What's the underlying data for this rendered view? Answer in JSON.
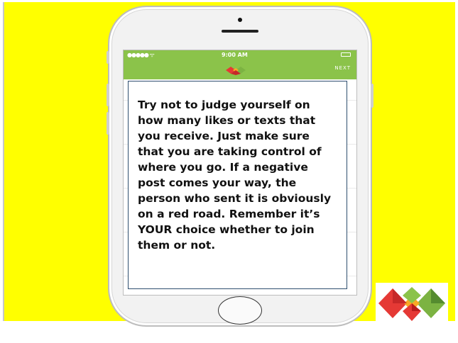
{
  "status_bar": {
    "signal": "●●●●● ᯤ",
    "time": "9:00 AM"
  },
  "nav_bar": {
    "next_label": "NEXT"
  },
  "message": {
    "text": "Try not to judge yourself on\nhow many likes or texts that\nyou receive. Just make sure\nthat you are taking control of\nwhere you go. If a negative\npost comes your way, the\nperson who sent it is obviously\non a red road. Remember it’s\nYOUR choice whether to join\nthem or not."
  },
  "colors": {
    "background": "#ffff00",
    "nav_green": "#8bc34a",
    "logo_red": "#e53935",
    "logo_green": "#7cb342",
    "logo_yellow": "#f9a825"
  },
  "icons": [
    "logo-icon",
    "battery-icon",
    "wifi-icon",
    "home-button"
  ]
}
